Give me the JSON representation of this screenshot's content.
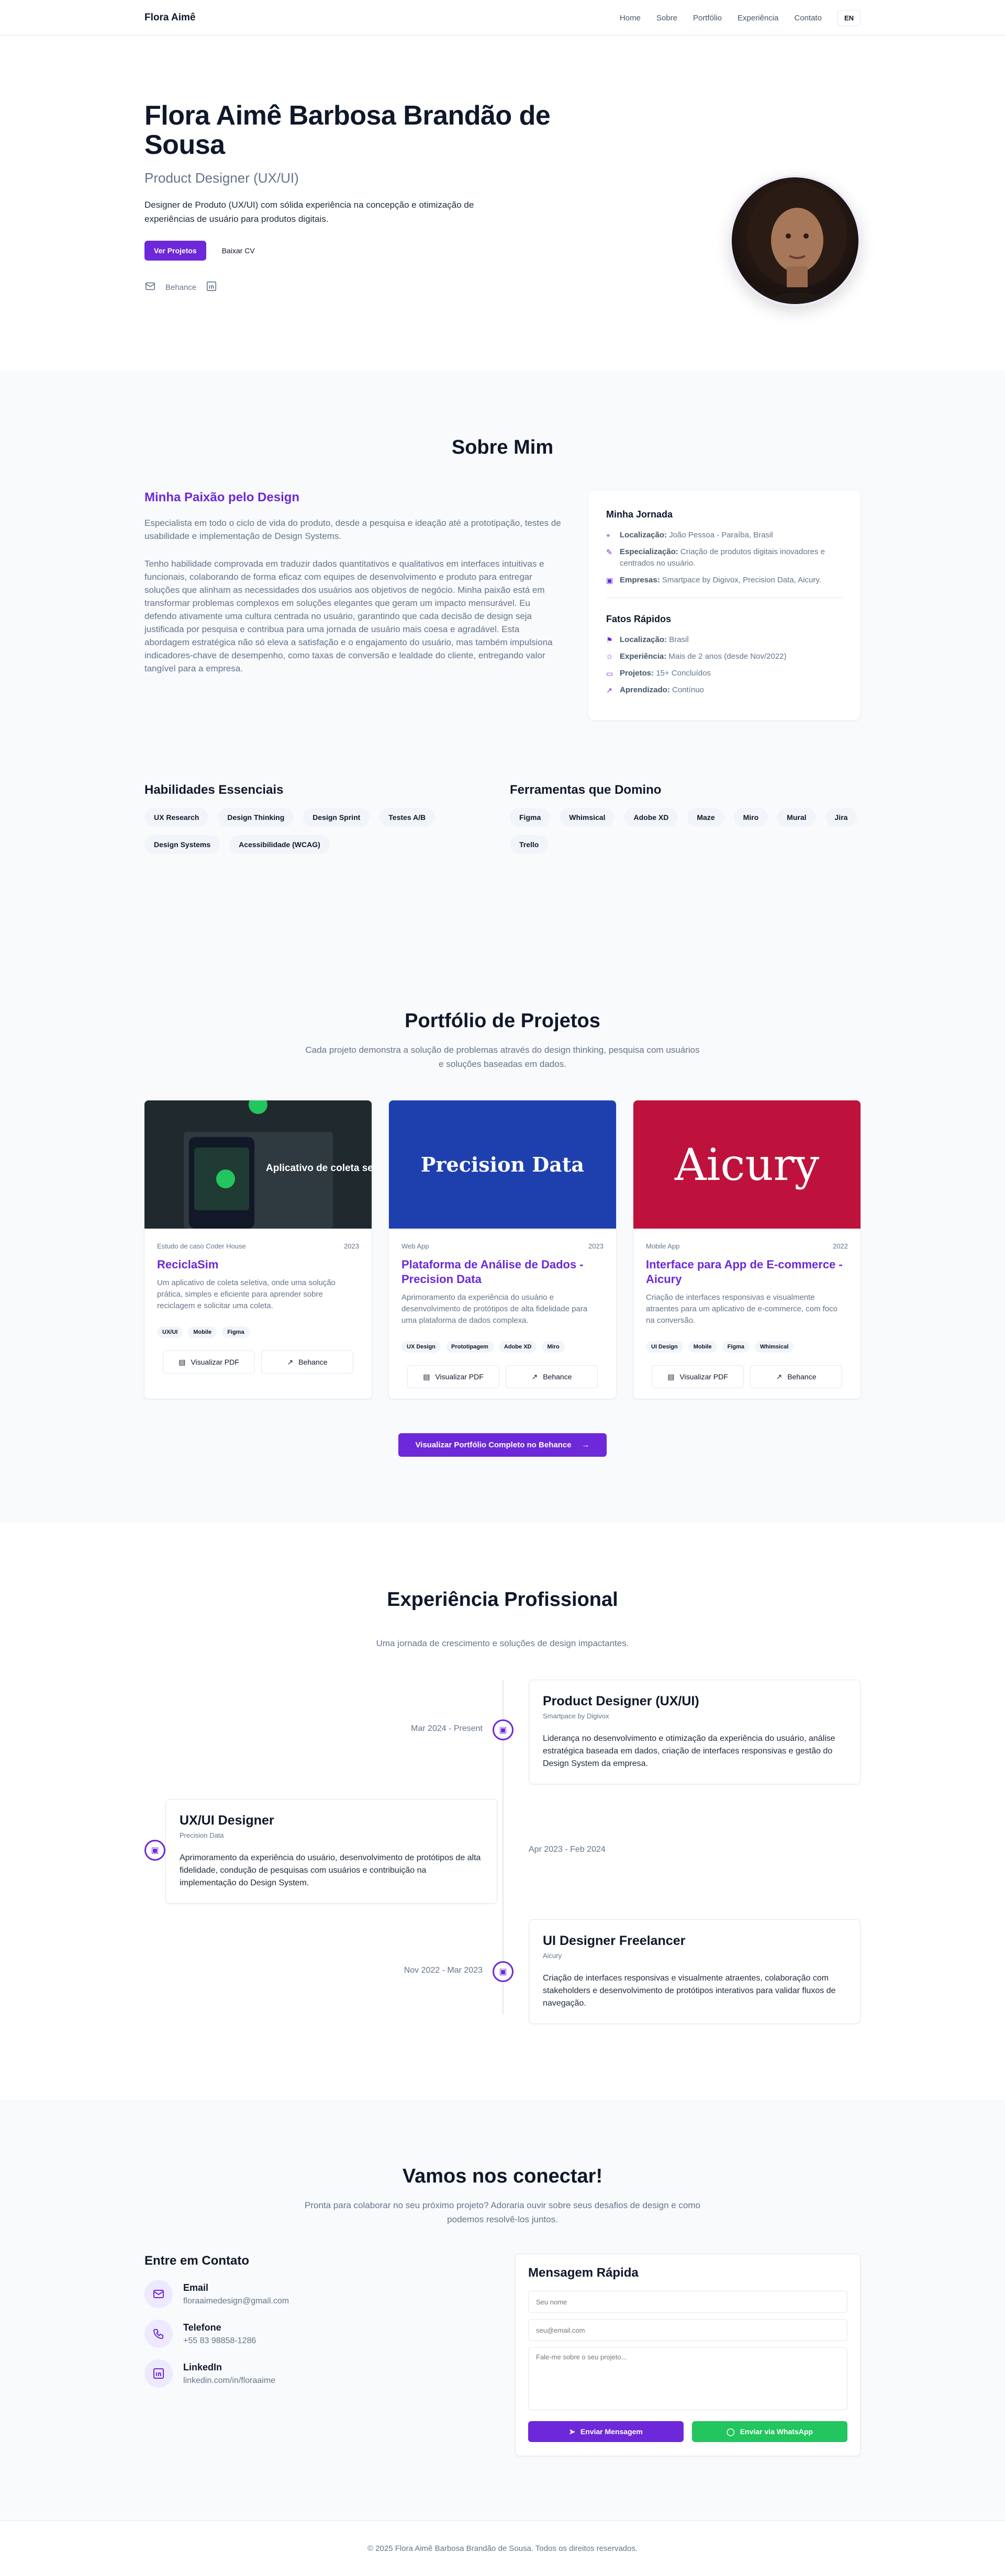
{
  "nav": {
    "brand": "Flora Aimê",
    "links": [
      "Home",
      "Sobre",
      "Portfólio",
      "Experiência",
      "Contato"
    ],
    "lang": "EN"
  },
  "hero": {
    "name": "Flora Aimê Barbosa Brandão de Sousa",
    "role": "Product Designer (UX/UI)",
    "description": "Designer de Produto (UX/UI) com sólida experiência na concepção e otimização de experiências de usuário para produtos digitais.",
    "primary_button": "Ver Projetos",
    "secondary_button": "Baixar CV",
    "social_behance": "Behance"
  },
  "about": {
    "title": "Sobre Mim",
    "heading": "Minha Paixão pelo Design",
    "paragraph1": "Especialista em todo o ciclo de vida do produto, desde a pesquisa e ideação até a prototipação, testes de usabilidade e implementação de Design Systems.",
    "paragraph2": "Tenho habilidade comprovada em traduzir dados quantitativos e qualitativos em interfaces intuitivas e funcionais, colaborando de forma eficaz com equipes de desenvolvimento e produto para entregar soluções que alinham as necessidades dos usuários aos objetivos de negócio. Minha paixão está em transformar problemas complexos em soluções elegantes que geram um impacto mensurável. Eu defendo ativamente uma cultura centrada no usuário, garantindo que cada decisão de design seja justificada por pesquisa e contribua para uma jornada de usuário mais coesa e agradável. Esta abordagem estratégica não só eleva a satisfação e o engajamento do usuário, mas também impulsiona indicadores-chave de desempenho, como taxas de conversão e lealdade do cliente, entregando valor tangível para a empresa.",
    "journey_title": "Minha Jornada",
    "journey": [
      {
        "label": "Localização:",
        "value": "João Pessoa - Paraíba, Brasil",
        "icon": "map-pin-icon"
      },
      {
        "label": "Especialização:",
        "value": "Criação de produtos digitais inovadores e centrados no usuário.",
        "icon": "brush-icon"
      },
      {
        "label": "Empresas:",
        "value": "Smartpace by Digivox, Precision Data, Aicury.",
        "icon": "briefcase-icon"
      }
    ],
    "facts_title": "Fatos Rápidos",
    "facts": [
      {
        "label": "Localização:",
        "value": "Brasil",
        "icon": "flag-icon"
      },
      {
        "label": "Experiência:",
        "value": "Mais de 2 anos (desde Nov/2022)",
        "icon": "star-icon"
      },
      {
        "label": "Projetos:",
        "value": "15+ Concluídos",
        "icon": "folder-icon"
      },
      {
        "label": "Aprendizado:",
        "value": "Contínuo",
        "icon": "trend-icon"
      }
    ],
    "skills_title": "Habilidades Essenciais",
    "skills": [
      "UX Research",
      "Design Thinking",
      "Design Sprint",
      "Testes A/B",
      "Design Systems",
      "Acessibilidade (WCAG)"
    ],
    "tools_title": "Ferramentas que Domino",
    "tools": [
      "Figma",
      "Whimsical",
      "Adobe XD",
      "Maze",
      "Miro",
      "Mural",
      "Jira",
      "Trello"
    ]
  },
  "portfolio": {
    "title": "Portfólio de Projetos",
    "subtitle": "Cada projeto demonstra a solução de problemas através do design thinking, pesquisa com usuários e soluções baseadas em dados.",
    "cards": [
      {
        "category": "Estudo de caso Coder House",
        "year": "2023",
        "title": "ReciclaSim",
        "description": "Um aplicativo de coleta seletiva, onde uma solução prática, simples e eficiente para aprender sobre reciclagem e solicitar uma coleta.",
        "tags": [
          "UX/UI",
          "Mobile",
          "Figma"
        ],
        "image_text": "Aplicativo de coleta seletiva",
        "color": "#1f2a2e",
        "pdf": "Visualizar PDF",
        "behance": "Behance"
      },
      {
        "category": "Web App",
        "year": "2023",
        "title": "Plataforma de Análise de Dados - Precision Data",
        "description": "Aprimoramento da experiência do usuário e desenvolvimento de protótipos de alta fidelidade para uma plataforma de dados complexa.",
        "tags": [
          "UX Design",
          "Prototipagem",
          "Adobe XD",
          "Miro"
        ],
        "image_text": "Precision Data",
        "color": "#1e40af",
        "pdf": "Visualizar PDF",
        "behance": "Behance"
      },
      {
        "category": "Mobile App",
        "year": "2022",
        "title": "Interface para App de E-commerce - Aicury",
        "description": "Criação de interfaces responsivas e visualmente atraentes para um aplicativo de e-commerce, com foco na conversão.",
        "tags": [
          "UI Design",
          "Mobile",
          "Figma",
          "Whimsical"
        ],
        "image_text": "Aicury",
        "color": "#be123c",
        "pdf": "Visualizar PDF",
        "behance": "Behance"
      }
    ],
    "cta": "Visualizar Portfólio Completo no Behance"
  },
  "experience": {
    "title": "Experiência Profissional",
    "subtitle": "Uma jornada de crescimento e soluções de design impactantes.",
    "items": [
      {
        "title": "Product Designer (UX/UI)",
        "company": "Smartpace by Digivox",
        "date": "Mar 2024 - Present",
        "description": "Liderança no desenvolvimento e otimização da experiência do usuário, análise estratégica baseada em dados, criação de interfaces responsivas e gestão do Design System da empresa."
      },
      {
        "title": "UX/UI Designer",
        "company": "Precision Data",
        "date": "Apr 2023 - Feb 2024",
        "description": "Aprimoramento da experiência do usuário, desenvolvimento de protótipos de alta fidelidade, condução de pesquisas com usuários e contribuição na implementação do Design System."
      },
      {
        "title": "UI Designer Freelancer",
        "company": "Aicury",
        "date": "Nov 2022 - Mar 2023",
        "description": "Criação de interfaces responsivas e visualmente atraentes, colaboração com stakeholders e desenvolvimento de protótipos interativos para validar fluxos de navegação."
      }
    ]
  },
  "contact": {
    "title": "Vamos nos conectar!",
    "subtitle": "Pronta para colaborar no seu próximo projeto? Adoraria ouvir sobre seus desafios de design e como podemos resolvê-los juntos.",
    "left_title": "Entre em Contato",
    "items": [
      {
        "label": "Email",
        "value": "floraaimedesign@gmail.com",
        "icon": "mail-icon"
      },
      {
        "label": "Telefone",
        "value": "+55 83 98858-1286",
        "icon": "phone-icon"
      },
      {
        "label": "LinkedIn",
        "value": "linkedin.com/in/floraaime",
        "icon": "linkedin-icon"
      }
    ],
    "form_title": "Mensagem Rápida",
    "name_placeholder": "Seu nome",
    "email_placeholder": "seu@email.com",
    "message_placeholder": "Fale-me sobre o seu projeto...",
    "send_button": "Enviar Mensagem",
    "whatsapp_button": "Enviar via WhatsApp"
  },
  "footer": {
    "text": "© 2025 Flora Aimê Barbosa Brandão de Sousa. Todos os direitos reservados."
  },
  "colors": {
    "accent": "#6d28d9",
    "whatsapp": "#22c55e"
  }
}
